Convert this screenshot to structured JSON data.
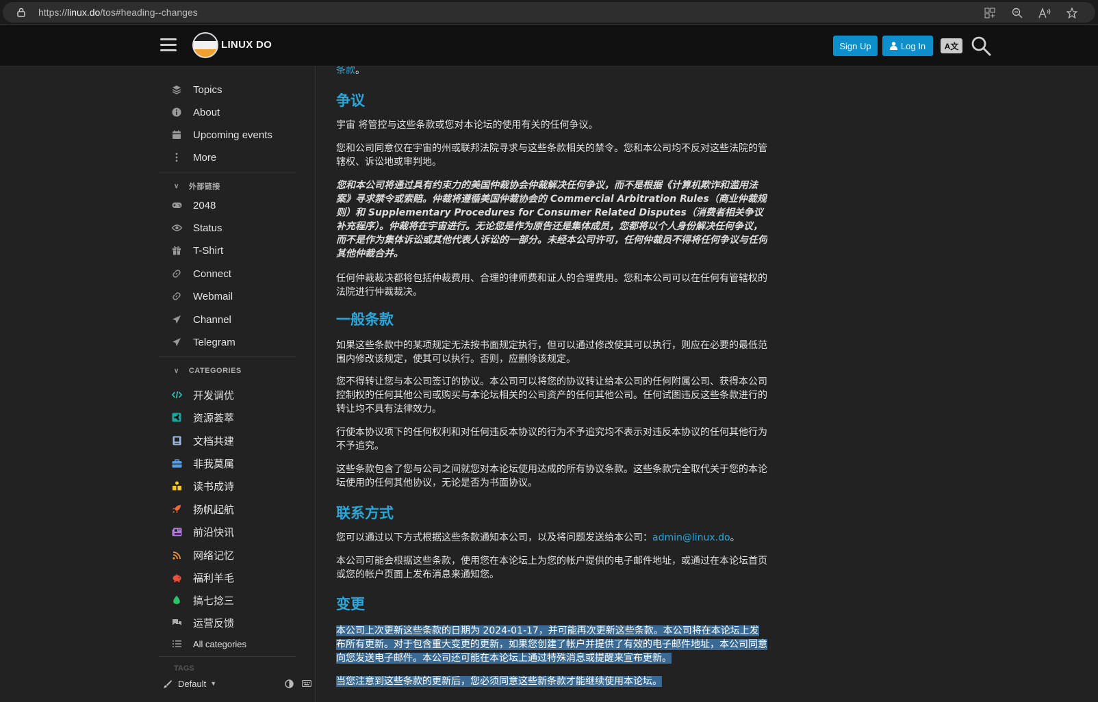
{
  "browser": {
    "url_prefix": "https://",
    "url_host": "linux.do",
    "url_path": "/tos#heading--changes"
  },
  "header": {
    "site_title": "LINUX DO",
    "signup_label": "Sign Up",
    "login_label": "Log In",
    "translate_label": "A文"
  },
  "sidebar": {
    "nav": [
      {
        "label": "Topics",
        "icon": "layers-icon"
      },
      {
        "label": "About",
        "icon": "info-icon"
      },
      {
        "label": "Upcoming events",
        "icon": "calendar-icon"
      },
      {
        "label": "More",
        "icon": "more-icon"
      }
    ],
    "external_heading": "外部链接",
    "external": [
      {
        "label": "2048",
        "icon": "gamepad-icon"
      },
      {
        "label": "Status",
        "icon": "eye-icon"
      },
      {
        "label": "T-Shirt",
        "icon": "gift-icon"
      },
      {
        "label": "Connect",
        "icon": "link-icon"
      },
      {
        "label": "Webmail",
        "icon": "link-icon"
      },
      {
        "label": "Channel",
        "icon": "send-icon"
      },
      {
        "label": "Telegram",
        "icon": "send-icon"
      }
    ],
    "categories_heading": "CATEGORIES",
    "categories": [
      {
        "label": "开发调优",
        "color": "#27c7c0"
      },
      {
        "label": "资源荟萃",
        "color": "#12a89d"
      },
      {
        "label": "文档共建",
        "color": "#9eb8e6"
      },
      {
        "label": "非我莫属",
        "color": "#5a9ee0"
      },
      {
        "label": "读书成诗",
        "color": "#f2c92e"
      },
      {
        "label": "扬帆起航",
        "color": "#f06a3a"
      },
      {
        "label": "前沿快讯",
        "color": "#b07ad6"
      },
      {
        "label": "网络记忆",
        "color": "#f09030"
      },
      {
        "label": "福利羊毛",
        "color": "#e8503a"
      },
      {
        "label": "搞七捻三",
        "color": "#2ec46a"
      },
      {
        "label": "运营反馈",
        "color": "#aaaaaa"
      }
    ],
    "all_categories": "All categories",
    "tags_heading": "TAGS",
    "theme_label": "Default"
  },
  "content": {
    "top_fragment_link": "条款",
    "top_fragment_end": "。",
    "disputes_heading": "争议",
    "disputes_p1": "宇宙 将管控与这些条款或您对本论坛的使用有关的任何争议。",
    "disputes_p2": "您和公司同意仅在宇宙的州或联邦法院寻求与这些条款相关的禁令。您和本公司均不反对这些法院的管辖权、诉讼地或审判地。",
    "disputes_p3": "您和本公司将通过具有约束力的美国仲裁协会仲裁解决任何争议，而不是根据《计算机欺诈和滥用法案》寻求禁令或索赔。仲裁将遵循美国仲裁协会的 Commercial Arbitration Rules（商业仲裁规则）和 Supplementary Procedures for Consumer Related Disputes（消费者相关争议补充程序）。仲裁将在宇宙进行。无论您是作为原告还是集体成员，您都将以个人身份解决任何争议，而不是作为集体诉讼或其他代表人诉讼的一部分。未经本公司许可，任何仲裁员不得将任何争议与任何其他仲裁合并。",
    "disputes_p4": "任何仲裁裁决都将包括仲裁费用、合理的律师费和证人的合理费用。您和本公司可以在任何有管辖权的法院进行仲裁裁决。",
    "general_heading": "一般条款",
    "general_p1": "如果这些条款中的某项规定无法按书面规定执行，但可以通过修改使其可以执行，则应在必要的最低范围内修改该规定，使其可以执行。否则，应删除该规定。",
    "general_p2": "您不得转让您与本公司签订的协议。本公司可以将您的协议转让给本公司的任何附属公司、获得本公司控制权的任何其他公司或购买与本论坛相关的公司资产的任何其他公司。任何试图违反这些条款进行的转让均不具有法律效力。",
    "general_p3": "行使本协议项下的任何权利和对任何违反本协议的行为不予追究均不表示对违反本协议的任何其他行为不予追究。",
    "general_p4": "这些条款包含了您与公司之间就您对本论坛使用达成的所有协议条款。这些条款完全取代关于您的本论坛使用的任何其他协议，无论是否为书面协议。",
    "contact_heading": "联系方式",
    "contact_p1_text": "您可以通过以下方式根据这些条款通知本公司，以及将问题发送给本公司：",
    "contact_email": "admin@linux.do",
    "contact_p1_end": "。",
    "contact_p2": "本公司可能会根据这些条款，使用您在本论坛上为您的帐户提供的电子邮件地址，或通过在本论坛首页或您的帐户页面上发布消息来通知您。",
    "changes_heading": "变更",
    "changes_p1": "本公司上次更新这些条款的日期为 2024-01-17，并可能再次更新这些条款。本公司将在本论坛上发布所有更新。对于包含重大变更的更新，如果您创建了帐户并提供了有效的电子邮件地址，本公司同意向您发送电子邮件。本公司还可能在本论坛上通过特殊消息或提醒来宣布更新。",
    "changes_p2": "当您注意到这些条款的更新后，您必须同意这些新条款才能继续使用本论坛。"
  }
}
